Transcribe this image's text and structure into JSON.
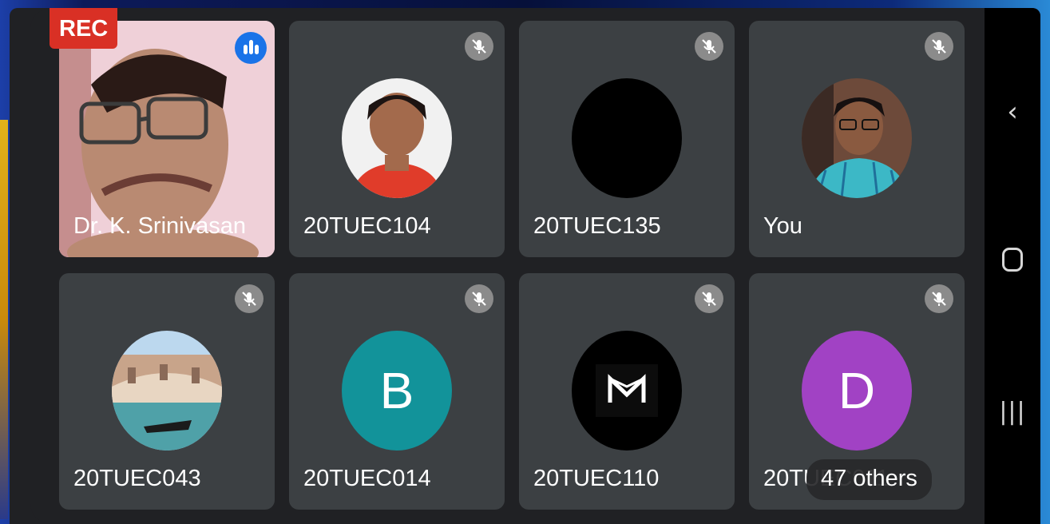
{
  "recording": {
    "label": "REC"
  },
  "participants": [
    {
      "name": "Dr. K. Srinivasan",
      "muted": false,
      "speaking": true,
      "avatar_type": "video"
    },
    {
      "name": "20TUEC104",
      "muted": true,
      "avatar_type": "photo"
    },
    {
      "name": "20TUEC135",
      "muted": true,
      "avatar_type": "blank"
    },
    {
      "name": "You",
      "muted": true,
      "avatar_type": "photo"
    },
    {
      "name": "20TUEC043",
      "muted": true,
      "avatar_type": "photo"
    },
    {
      "name": "20TUEC014",
      "muted": true,
      "avatar_type": "letter",
      "letter": "B",
      "color": "#12939a"
    },
    {
      "name": "20TUEC110",
      "muted": true,
      "avatar_type": "logo",
      "color": "#000000"
    },
    {
      "name": "20TUEC011",
      "muted": true,
      "avatar_type": "letter",
      "letter": "D",
      "color": "#a142c4"
    }
  ],
  "others": {
    "label": "47 others"
  },
  "icons": {
    "mute": "mic-off-icon",
    "speaking": "audio-level-icon",
    "nav_back": "chevron-left-icon",
    "nav_home": "home-icon",
    "nav_recents": "recents-icon"
  },
  "colors": {
    "tile_bg": "#3c4043",
    "rec_badge": "#d93025",
    "speaking": "#1a73e8",
    "screen_bg": "#202124"
  }
}
